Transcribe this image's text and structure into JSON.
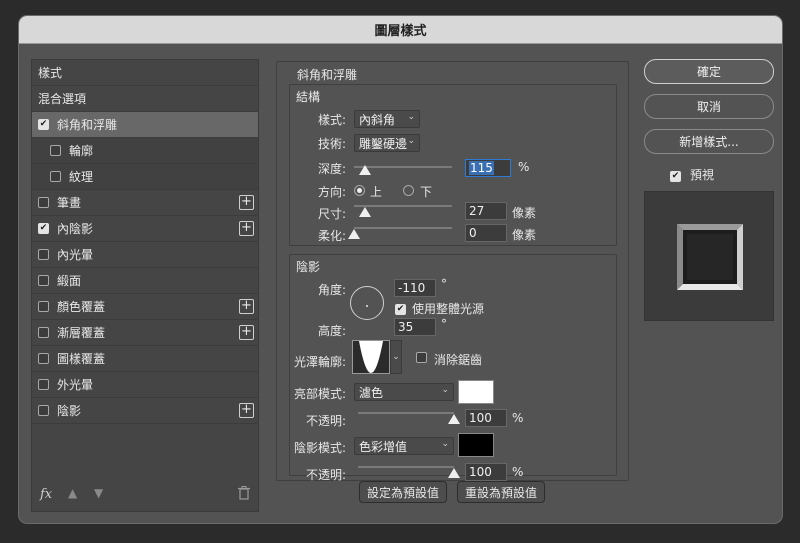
{
  "dialog": {
    "title": "圖層樣式"
  },
  "left_panel": {
    "items": [
      {
        "label": "樣式",
        "checkbox": false,
        "checked": false,
        "plus": false,
        "indent": false,
        "selected": false,
        "sub": false
      },
      {
        "label": "混合選項",
        "checkbox": false,
        "checked": false,
        "plus": false,
        "indent": false,
        "selected": false,
        "sub": false
      },
      {
        "label": "斜角和浮雕",
        "checkbox": true,
        "checked": true,
        "plus": false,
        "indent": false,
        "selected": true,
        "sub": false
      },
      {
        "label": "輪廓",
        "checkbox": true,
        "checked": false,
        "plus": false,
        "indent": true,
        "selected": false,
        "sub": true
      },
      {
        "label": "紋理",
        "checkbox": true,
        "checked": false,
        "plus": false,
        "indent": true,
        "selected": false,
        "sub": true
      },
      {
        "label": "筆畫",
        "checkbox": true,
        "checked": false,
        "plus": true,
        "indent": false,
        "selected": false,
        "sub": false
      },
      {
        "label": "內陰影",
        "checkbox": true,
        "checked": true,
        "plus": true,
        "indent": false,
        "selected": false,
        "sub": false
      },
      {
        "label": "內光暈",
        "checkbox": true,
        "checked": false,
        "plus": false,
        "indent": false,
        "selected": false,
        "sub": false
      },
      {
        "label": "緞面",
        "checkbox": true,
        "checked": false,
        "plus": false,
        "indent": false,
        "selected": false,
        "sub": false
      },
      {
        "label": "顏色覆蓋",
        "checkbox": true,
        "checked": false,
        "plus": true,
        "indent": false,
        "selected": false,
        "sub": false
      },
      {
        "label": "漸層覆蓋",
        "checkbox": true,
        "checked": false,
        "plus": true,
        "indent": false,
        "selected": false,
        "sub": false
      },
      {
        "label": "圖樣覆蓋",
        "checkbox": true,
        "checked": false,
        "plus": false,
        "indent": false,
        "selected": false,
        "sub": false
      },
      {
        "label": "外光暈",
        "checkbox": true,
        "checked": false,
        "plus": false,
        "indent": false,
        "selected": false,
        "sub": false
      },
      {
        "label": "陰影",
        "checkbox": true,
        "checked": false,
        "plus": true,
        "indent": false,
        "selected": false,
        "sub": false
      }
    ],
    "footer": {
      "fx_label": "fx",
      "up_icon": "arrow-up-icon",
      "down_icon": "arrow-down-icon",
      "trash_icon": "trash-icon"
    }
  },
  "bevel": {
    "panel_title": "斜角和浮雕",
    "structure_title": "結構",
    "style_label": "樣式:",
    "style_value": "內斜角",
    "technique_label": "技術:",
    "technique_value": "雕鑿硬邊",
    "depth_label": "深度:",
    "depth_value": "115",
    "depth_unit": "%",
    "depth_fraction": 0.115,
    "direction_label": "方向:",
    "direction_up": "上",
    "direction_down": "下",
    "direction_selected": "up",
    "size_label": "尺寸:",
    "size_value": "27",
    "size_unit": "像素",
    "size_fraction": 0.108,
    "soften_label": "柔化:",
    "soften_value": "0",
    "soften_unit": "像素",
    "soften_fraction": 0.0
  },
  "shading": {
    "title": "陰影",
    "angle_label": "角度:",
    "angle_value": "-110",
    "angle_unit": "°",
    "global_light_label": "使用整體光源",
    "global_light_checked": true,
    "altitude_label": "高度:",
    "altitude_value": "35",
    "altitude_unit": "°",
    "gloss_label": "光澤輪廓:",
    "antialias_label": "消除鋸齒",
    "antialias_checked": false,
    "highlight_mode_label": "亮部模式:",
    "highlight_mode_value": "濾色",
    "highlight_color": "#ffffff",
    "highlight_opacity_label": "不透明:",
    "highlight_opacity_value": "100",
    "highlight_opacity_unit": "%",
    "highlight_opacity_fraction": 1.0,
    "shadow_mode_label": "陰影模式:",
    "shadow_mode_value": "色彩增值",
    "shadow_color": "#000000",
    "shadow_opacity_label": "不透明:",
    "shadow_opacity_value": "100",
    "shadow_opacity_unit": "%",
    "shadow_opacity_fraction": 1.0
  },
  "bottom_buttons": {
    "make_default": "設定為預設值",
    "reset_default": "重設為預設值"
  },
  "right_panel": {
    "ok_label": "確定",
    "cancel_label": "取消",
    "new_style_label": "新增樣式...",
    "preview_label": "預視",
    "preview_checked": true
  }
}
